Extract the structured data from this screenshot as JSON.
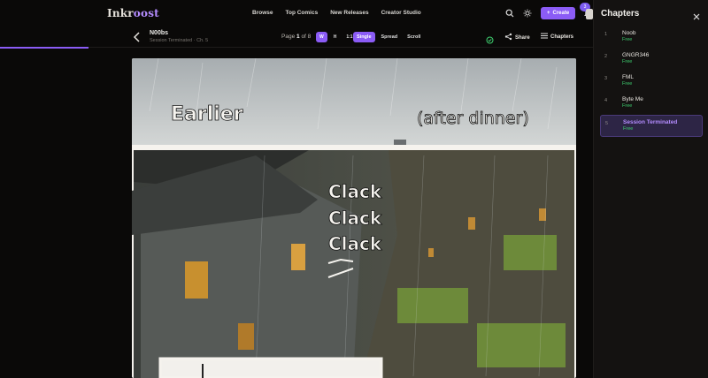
{
  "brand": {
    "prefix": "Inkr",
    "accent": "oost"
  },
  "nav": [
    "Browse",
    "Top Comics",
    "New Releases",
    "Creator Studio"
  ],
  "topbar": {
    "create_label": "Create",
    "notifications_count": "3"
  },
  "reader": {
    "series_title": "N00bs",
    "chapter_sub": "Session Terminated · Ch. 5",
    "page_label": "Page",
    "page_current": "1",
    "page_of": "of",
    "page_total": "8",
    "zoom": [
      "W",
      "H",
      "1:1"
    ],
    "modes": [
      "Single",
      "Spread",
      "Scroll"
    ],
    "share_label": "Share",
    "chapters_label": "Chapters"
  },
  "page_art": {
    "caption_left": "Earlier",
    "caption_right": "(after dinner)",
    "sfx": [
      "Clack",
      "Clack",
      "Clack"
    ]
  },
  "sidebar": {
    "title": "Chapters",
    "items": [
      {
        "num": "1",
        "name": "Noob",
        "price": "Free"
      },
      {
        "num": "2",
        "name": "GNGR346",
        "price": "Free"
      },
      {
        "num": "3",
        "name": "FML",
        "price": "Free"
      },
      {
        "num": "4",
        "name": "Byte Me",
        "price": "Free"
      },
      {
        "num": "5",
        "name": "Session Terminated",
        "price": "Free"
      }
    ],
    "active_index": 4
  },
  "colors": {
    "accent": "#8b5cf6",
    "free": "#3ecf6f"
  }
}
